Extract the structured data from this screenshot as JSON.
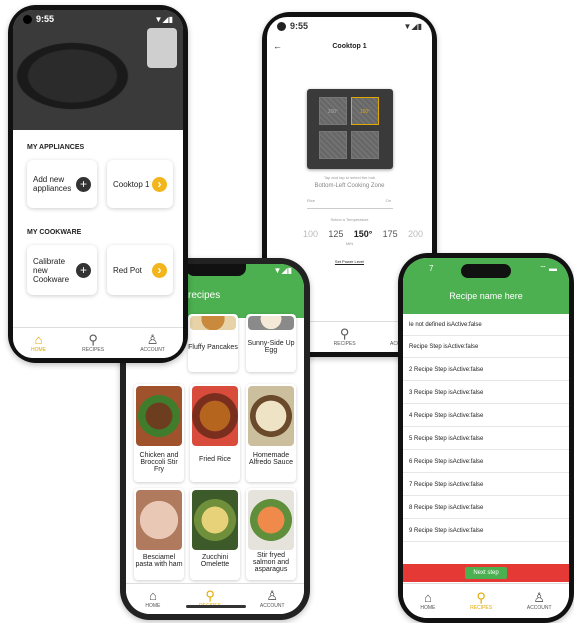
{
  "phone1": {
    "status_time": "9:55",
    "section_appliances": "MY APPLIANCES",
    "add_appliance_label": "Add new appliances",
    "cooktop_label": "Cooktop 1",
    "section_cookware": "MY COOKWARE",
    "calibrate_label": "Calibrate new Cookware",
    "red_pot_label": "Red Pot"
  },
  "phone2": {
    "status_time": "9:55",
    "title": "Cooktop 1",
    "hint": "Tap and tap to select the hob",
    "zone_name": "Bottom-Left Cooking Zone",
    "zone_tl": "200°",
    "zone_tr": "150°",
    "field_left": "Rice",
    "field_right": "On",
    "temp_label": "Select a Temperature",
    "temps": [
      "100",
      "125",
      "150°",
      "175",
      "200"
    ],
    "temp_unit": "MIN",
    "power_link": "Set Power Level"
  },
  "phone3": {
    "header_title": "recipes",
    "recipes": [
      {
        "name": "Fluffy Pancakes"
      },
      {
        "name": "Sunny-Side Up Egg"
      },
      {
        "name": "Chicken and Broccoli Stir Fry"
      },
      {
        "name": "Fried Rice"
      },
      {
        "name": "Homemade Alfredo Sauce"
      },
      {
        "name": "Besciamel pasta with ham"
      },
      {
        "name": "Zucchini Omelette"
      },
      {
        "name": "Stir fryed salmon and asparagus"
      }
    ]
  },
  "phone4": {
    "status_time": "7",
    "header_title": "Recipe name here",
    "first_row": "le not defined isActive:false",
    "steps": [
      "Recipe Step isActive:false",
      "2 Recipe Step isActive:false",
      "3 Recipe Step isActive:false",
      "4 Recipe Step isActive:false",
      "5 Recipe Step isActive:false",
      "6 Recipe Step isActive:false",
      "7 Recipe Step isActive:false",
      "8 Recipe Step isActive:false",
      "9 Recipe Step isActive:false"
    ],
    "next_button": "Next step"
  },
  "nav": {
    "home": "HOME",
    "recipes": "RECIPES",
    "account": "ACCOUNT"
  },
  "colors": {
    "accent_green": "#4caf50",
    "accent_yellow": "#f2b61c",
    "red_bar": "#e53935"
  }
}
